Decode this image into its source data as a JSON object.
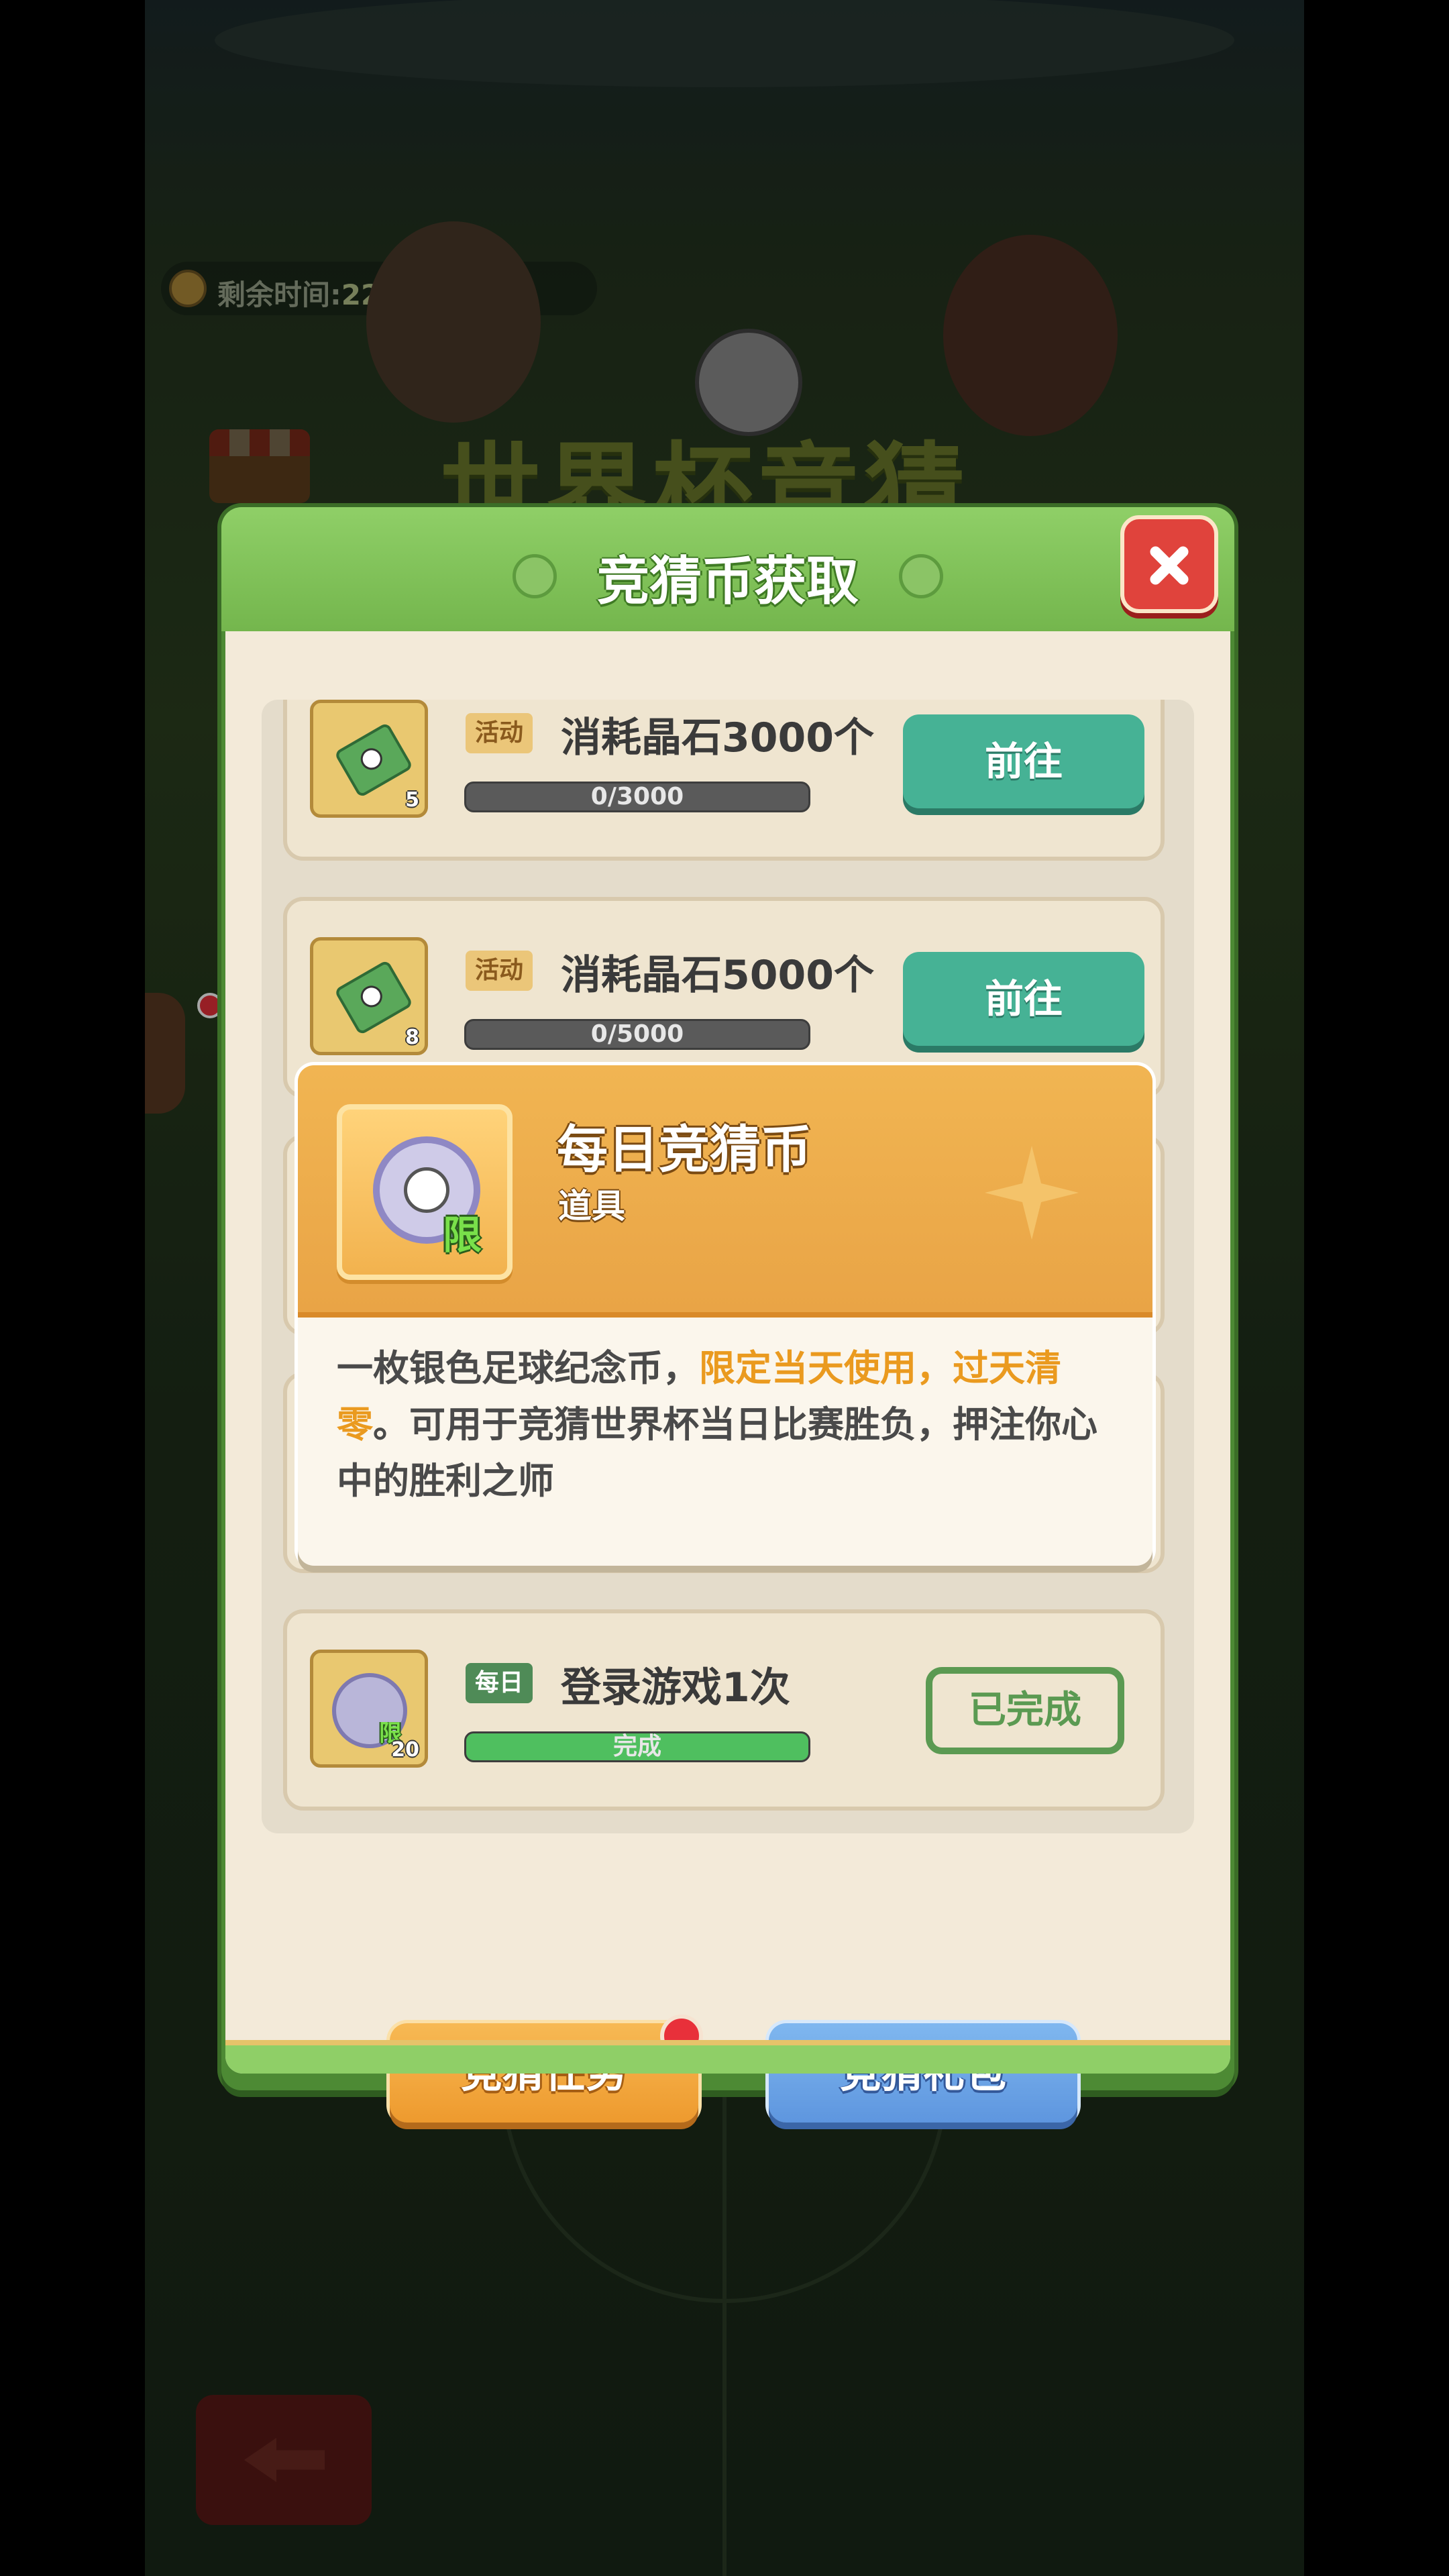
{
  "background": {
    "timer_label": "剩余时间:",
    "timer_value": "22天14小时",
    "event_title": "世界杯竞猜"
  },
  "dialog": {
    "title": "竞猜币获取",
    "tasks": [
      {
        "tag": "活动",
        "title": "消耗晶石3000个",
        "icon": "ticket-icon",
        "reward_count": "5",
        "progress_text": "0/3000",
        "progress": 0,
        "button": "前往"
      },
      {
        "tag": "活动",
        "title": "消耗晶石5000个",
        "icon": "ticket-icon",
        "reward_count": "8",
        "progress_text": "0/5000",
        "progress": 0,
        "button": "前往"
      },
      {
        "tag": "每日",
        "title": "登录游戏1次",
        "icon": "silver-coin-icon",
        "icon_badge": "限",
        "reward_count": "20",
        "progress_text": "完成",
        "progress": 1.0,
        "button": "已完成"
      }
    ],
    "footer_buttons": {
      "tasks": "竞猜任务",
      "gift": "竞猜礼包"
    }
  },
  "tooltip": {
    "name": "每日竞猜币",
    "type": "道具",
    "badge": "限",
    "desc_part1": "一枚银色足球纪念币，",
    "desc_highlight": "限定当天使用，过天清零",
    "desc_part2": "。可用于竞猜世界杯当日比赛胜负，押注你心中的胜利之师"
  },
  "colors": {
    "header_green": "#74b64d",
    "go_button": "#46b295",
    "highlight_orange": "#ea9a1f",
    "tasks_button": "#ee9a2e",
    "gift_button": "#5e96df",
    "close_red": "#e0433c"
  }
}
